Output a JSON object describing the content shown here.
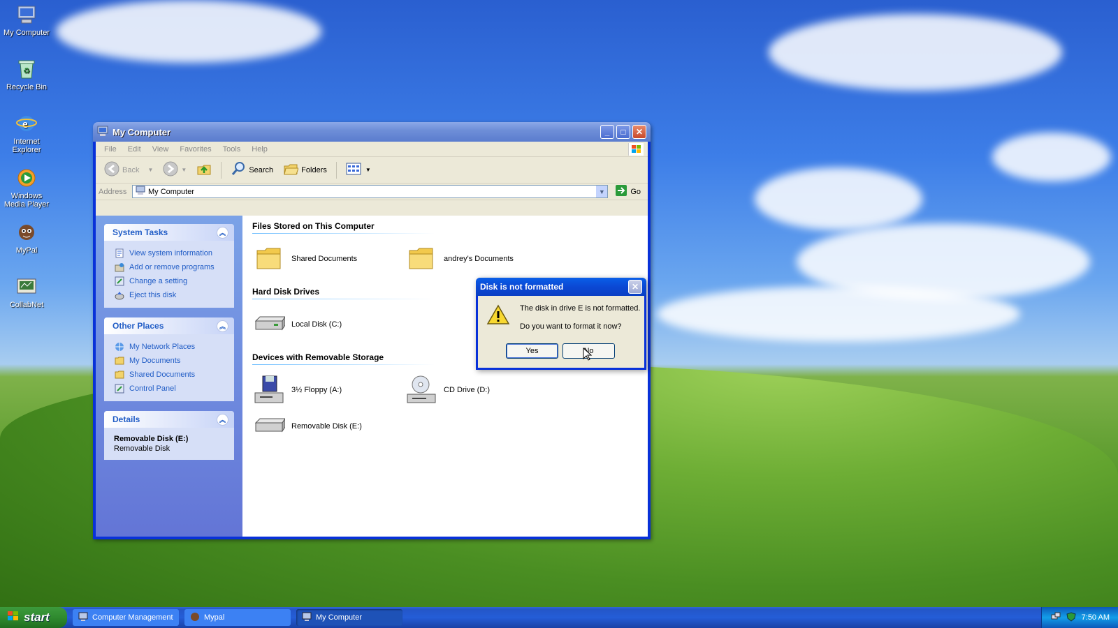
{
  "desktop": {
    "icons": [
      {
        "label": "My Computer"
      },
      {
        "label": "Recycle Bin"
      },
      {
        "label": "Internet Explorer"
      },
      {
        "label": "Windows Media Player"
      },
      {
        "label": "MyPal"
      },
      {
        "label": "CollabNet"
      }
    ]
  },
  "window": {
    "title": "My Computer",
    "menu": [
      "File",
      "Edit",
      "View",
      "Favorites",
      "Tools",
      "Help"
    ],
    "toolbar": {
      "back": "Back",
      "search": "Search",
      "folders": "Folders"
    },
    "address": {
      "label": "Address",
      "value": "My Computer",
      "go": "Go"
    },
    "tasks_panels": {
      "system_tasks": {
        "title": "System Tasks",
        "items": [
          "View system information",
          "Add or remove programs",
          "Change a setting",
          "Eject this disk"
        ]
      },
      "other_places": {
        "title": "Other Places",
        "items": [
          "My Network Places",
          "My Documents",
          "Shared Documents",
          "Control Panel"
        ]
      },
      "details": {
        "title": "Details",
        "name": "Removable Disk (E:)",
        "type": "Removable Disk"
      }
    },
    "groups": {
      "files": {
        "title": "Files Stored on This Computer",
        "items": [
          "Shared Documents",
          "andrey's Documents"
        ]
      },
      "hdd": {
        "title": "Hard Disk Drives",
        "items": [
          "Local Disk (C:)"
        ]
      },
      "removable": {
        "title": "Devices with Removable Storage",
        "items": [
          "3½ Floppy (A:)",
          "CD Drive (D:)",
          "Removable Disk (E:)"
        ]
      }
    }
  },
  "dialog": {
    "title": "Disk is not formatted",
    "message1": "The disk in drive E is not formatted.",
    "message2": "Do you want to format it now?",
    "yes": "Yes",
    "no": "No"
  },
  "taskbar": {
    "start": "start",
    "tasks": [
      "Computer Management",
      "Mypal",
      "My Computer"
    ],
    "clock": "7:50 AM"
  },
  "colors": {
    "titlebar_active": "#0a48d4",
    "link": "#215dc6",
    "start_green": "#2f8a2f"
  }
}
